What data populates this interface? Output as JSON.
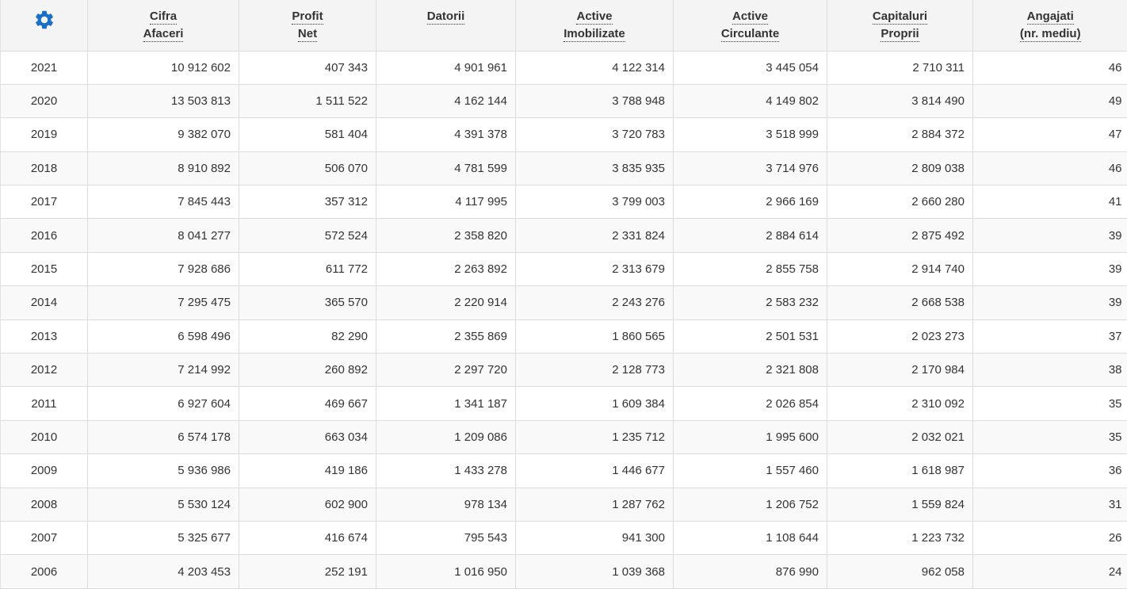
{
  "header": {
    "settings_icon": "gear-icon",
    "accent_color": "#1a6fc9",
    "columns": [
      {
        "line1": "Cifra",
        "line2": "Afaceri"
      },
      {
        "line1": "Profit",
        "line2": "Net"
      },
      {
        "line1": "Datorii",
        "line2": ""
      },
      {
        "line1": "Active",
        "line2": "Imobilizate"
      },
      {
        "line1": "Active",
        "line2": "Circulante"
      },
      {
        "line1": "Capitaluri",
        "line2": "Proprii"
      },
      {
        "line1": "Angajati",
        "line2": "(nr. mediu)"
      }
    ]
  },
  "rows": [
    [
      "2021",
      "10 912 602",
      "407 343",
      "4 901 961",
      "4 122 314",
      "3 445 054",
      "2 710 311",
      "46"
    ],
    [
      "2020",
      "13 503 813",
      "1 511 522",
      "4 162 144",
      "3 788 948",
      "4 149 802",
      "3 814 490",
      "49"
    ],
    [
      "2019",
      "9 382 070",
      "581 404",
      "4 391 378",
      "3 720 783",
      "3 518 999",
      "2 884 372",
      "47"
    ],
    [
      "2018",
      "8 910 892",
      "506 070",
      "4 781 599",
      "3 835 935",
      "3 714 976",
      "2 809 038",
      "46"
    ],
    [
      "2017",
      "7 845 443",
      "357 312",
      "4 117 995",
      "3 799 003",
      "2 966 169",
      "2 660 280",
      "41"
    ],
    [
      "2016",
      "8 041 277",
      "572 524",
      "2 358 820",
      "2 331 824",
      "2 884 614",
      "2 875 492",
      "39"
    ],
    [
      "2015",
      "7 928 686",
      "611 772",
      "2 263 892",
      "2 313 679",
      "2 855 758",
      "2 914 740",
      "39"
    ],
    [
      "2014",
      "7 295 475",
      "365 570",
      "2 220 914",
      "2 243 276",
      "2 583 232",
      "2 668 538",
      "39"
    ],
    [
      "2013",
      "6 598 496",
      "82 290",
      "2 355 869",
      "1 860 565",
      "2 501 531",
      "2 023 273",
      "37"
    ],
    [
      "2012",
      "7 214 992",
      "260 892",
      "2 297 720",
      "2 128 773",
      "2 321 808",
      "2 170 984",
      "38"
    ],
    [
      "2011",
      "6 927 604",
      "469 667",
      "1 341 187",
      "1 609 384",
      "2 026 854",
      "2 310 092",
      "35"
    ],
    [
      "2010",
      "6 574 178",
      "663 034",
      "1 209 086",
      "1 235 712",
      "1 995 600",
      "2 032 021",
      "35"
    ],
    [
      "2009",
      "5 936 986",
      "419 186",
      "1 433 278",
      "1 446 677",
      "1 557 460",
      "1 618 987",
      "36"
    ],
    [
      "2008",
      "5 530 124",
      "602 900",
      "978 134",
      "1 287 762",
      "1 206 752",
      "1 559 824",
      "31"
    ],
    [
      "2007",
      "5 325 677",
      "416 674",
      "795 543",
      "941 300",
      "1 108 644",
      "1 223 732",
      "26"
    ],
    [
      "2006",
      "4 203 453",
      "252 191",
      "1 016 950",
      "1 039 368",
      "876 990",
      "962 058",
      "24"
    ]
  ]
}
